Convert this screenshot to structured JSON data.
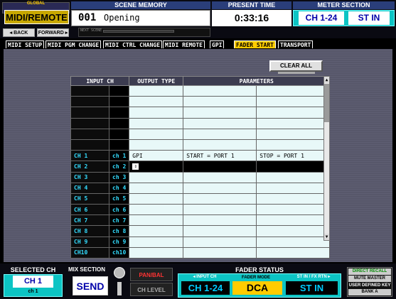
{
  "global": {
    "small": "GLOBAL",
    "title": "MIDI/REMOTE",
    "back": "◂ BACK",
    "forward": "FORWARD ▸"
  },
  "scene_memory": {
    "header": "SCENE MEMORY",
    "number": "001",
    "name": "Opening",
    "next_label": "NEXT SCENE"
  },
  "present_time": {
    "header": "PRESENT TIME",
    "value": "0:33:16"
  },
  "meter_section": {
    "header": "METER SECTION",
    "button1": "CH 1-24",
    "button2": "ST IN"
  },
  "tabs": [
    "MIDI SETUP",
    "MIDI PGM CHANGE",
    "MIDI CTRL CHANGE",
    "MIDI REMOTE",
    "GPI",
    "FADER START",
    "TRANSPORT"
  ],
  "active_tab": "FADER START",
  "clear_all": "CLEAR ALL",
  "table": {
    "headers": {
      "input_ch": "INPUT CH",
      "output_type": "OUTPUT TYPE",
      "parameters": "PARAMETERS"
    },
    "rows": [
      {
        "ch": "",
        "box": "",
        "type": "",
        "start": "",
        "stop": ""
      },
      {
        "ch": "",
        "box": "",
        "type": "",
        "start": "",
        "stop": ""
      },
      {
        "ch": "",
        "box": "",
        "type": "",
        "start": "",
        "stop": ""
      },
      {
        "ch": "",
        "box": "",
        "type": "",
        "start": "",
        "stop": ""
      },
      {
        "ch": "",
        "box": "",
        "type": "",
        "start": "",
        "stop": ""
      },
      {
        "ch": "",
        "box": "",
        "type": "",
        "start": "",
        "stop": ""
      },
      {
        "ch": "CH 1",
        "box": "ch 1",
        "type": "GPI",
        "start": "START = PORT 1",
        "stop": "STOP = PORT 1"
      },
      {
        "ch": "CH 2",
        "box": "ch 2",
        "type": "",
        "start": "",
        "stop": ""
      },
      {
        "ch": "CH 3",
        "box": "ch 3",
        "type": "",
        "start": "",
        "stop": ""
      },
      {
        "ch": "CH 4",
        "box": "ch 4",
        "type": "",
        "start": "",
        "stop": ""
      },
      {
        "ch": "CH 5",
        "box": "ch 5",
        "type": "",
        "start": "",
        "stop": ""
      },
      {
        "ch": "CH 6",
        "box": "ch 6",
        "type": "",
        "start": "",
        "stop": ""
      },
      {
        "ch": "CH 7",
        "box": "ch 7",
        "type": "",
        "start": "",
        "stop": ""
      },
      {
        "ch": "CH 8",
        "box": "ch 8",
        "type": "",
        "start": "",
        "stop": ""
      },
      {
        "ch": "CH 9",
        "box": "ch 9",
        "type": "",
        "start": "",
        "stop": ""
      },
      {
        "ch": "CH10",
        "box": "ch10",
        "type": "",
        "start": "",
        "stop": ""
      }
    ]
  },
  "bottom": {
    "selected_ch": {
      "header": "SELECTED CH",
      "value": "CH 1",
      "sub": "ch 1"
    },
    "mix_section": {
      "header": "MIX SECTION",
      "value": "SEND"
    },
    "pan_bal": "PAN/BAL",
    "ch_level": "CH LEVEL",
    "fader_status": {
      "header": "FADER STATUS",
      "input_ch_label": "◂ INPUT CH",
      "input_ch": "CH 1-24",
      "fader_mode_label": "FADER MODE",
      "fader_mode": "DCA",
      "stin_label": "ST IN / FX RTN ▸",
      "stin": "ST IN"
    },
    "udk": {
      "direct_recall": "DIRECT RECALL",
      "mute_master": "MUTE MASTER",
      "user_defined": "USER DEFINED KEY",
      "bank": "BANK A"
    }
  },
  "colors": {
    "accent_yellow": "#ffcc00",
    "cyan": "#0cc4c4",
    "channel_text": "#33ddff",
    "panel_bg": "#5a5a6e"
  }
}
